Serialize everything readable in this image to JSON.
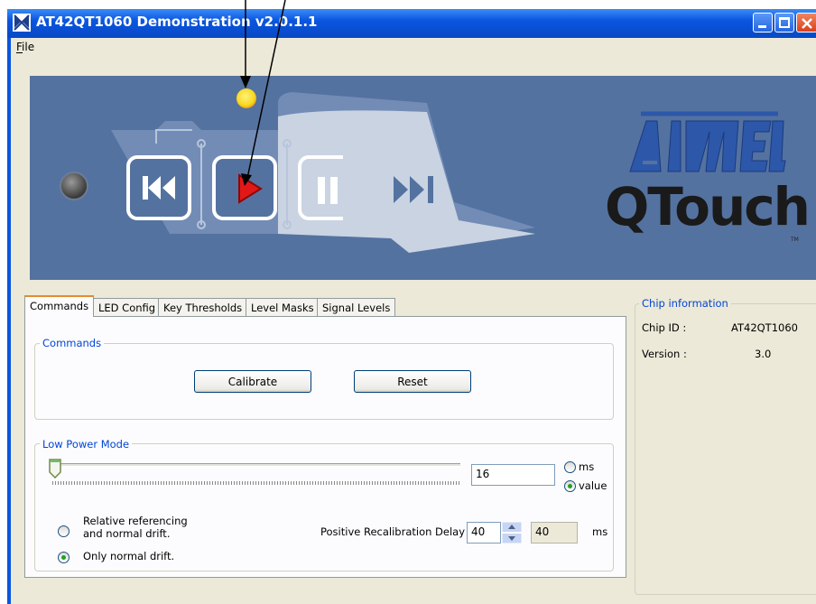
{
  "window": {
    "title": "AT42QT1060 Demonstration v2.0.1.1"
  },
  "menu": {
    "file": "File"
  },
  "tabs": [
    "Commands",
    "LED Config",
    "Key Thresholds",
    "Level Masks",
    "Signal Levels"
  ],
  "commands": {
    "legend": "Commands",
    "calibrate": "Calibrate",
    "reset": "Reset"
  },
  "low_power": {
    "legend": "Low Power Mode",
    "value": "16",
    "radio_ms": "ms",
    "radio_value": "value",
    "drift_relative": "Relative referencing\nand normal drift.",
    "drift_normal": "Only normal drift.",
    "recal_label": "Positive Recalibration Delay",
    "recal_value": "40",
    "recal_display": "40",
    "recal_unit": "ms"
  },
  "chip": {
    "legend": "Chip information",
    "id_label": "Chip ID :",
    "id_value": "AT42QT1060",
    "version_label": "Version :",
    "version_value": "3.0"
  },
  "banner": {
    "brand": "ATMEL",
    "product": "QTouch",
    "tm": "TM"
  },
  "colors": {
    "banner": "#5472a0",
    "titlebar": "#0a55e0",
    "led": "#f8d820",
    "play": "#e01818"
  }
}
